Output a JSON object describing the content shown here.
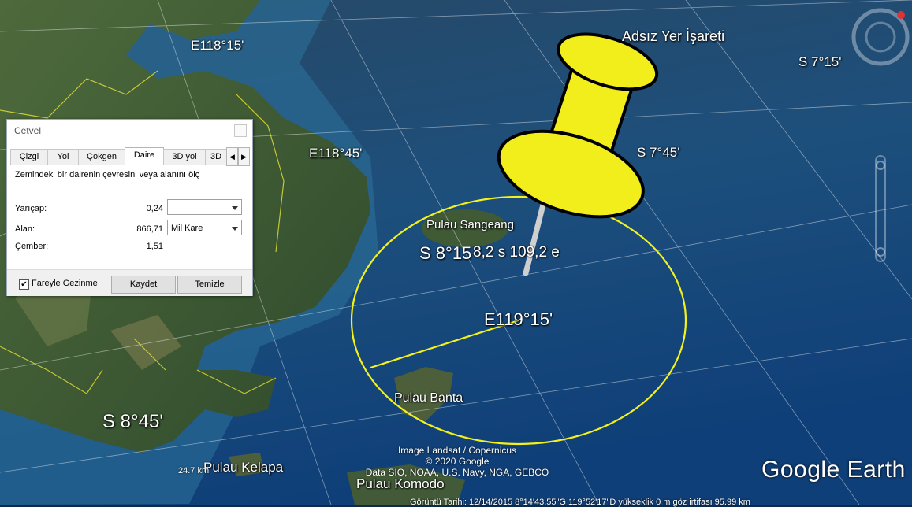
{
  "map": {
    "grid_labels": [
      {
        "id": "e118-15",
        "text": "E118°15'"
      },
      {
        "id": "e118-45",
        "text": "E118°45'"
      },
      {
        "id": "s7-15",
        "text": "S 7°15'"
      },
      {
        "id": "s7-45",
        "text": "S 7°45'"
      },
      {
        "id": "s8-15",
        "text": "S 8°15"
      },
      {
        "id": "e119-15",
        "text": "E119°15'"
      },
      {
        "id": "s8-45",
        "text": "S 8°45'"
      }
    ],
    "placemark_label": "Adsız Yer İşareti",
    "coord_overlay": "8,2 s 109,2 e",
    "islands": {
      "sangeang": "Pulau Sangeang",
      "banta": "Pulau Banta",
      "kelapa": "Pulau Kelapa",
      "komodo": "Pulau Komodo"
    },
    "credits": [
      "Image Landsat / Copernicus",
      "© 2020 Google",
      "Data SIO, NOAA, U.S. Navy, NGA, GEBCO"
    ],
    "logo": "Google Earth",
    "scale": "24.7 km",
    "status": "Görüntü Tarihi: 12/14/2015    8°14'43.55\"G  119°52'17\"D  yükseklik    0 m    göz irtifası  95.99 km",
    "colors": {
      "circle": "#f4f21a",
      "pin": "#f2ee1b"
    }
  },
  "ruler": {
    "title": "Cetvel",
    "tabs": [
      "Çizgi",
      "Yol",
      "Çokgen",
      "Daire",
      "3D yol",
      "3D"
    ],
    "active_tab": "Daire",
    "description": "Zemindeki bir dairenin çevresini veya alanını ölç",
    "radius_label": "Yarıçap:",
    "radius_value": "0,24",
    "radius_unit": "",
    "area_label": "Alan:",
    "area_value": "866,71",
    "area_unit": "Mil Kare",
    "circumference_label": "Çember:",
    "circumference_value": "1,51",
    "mouse_nav_label": "Fareyle Gezinme",
    "mouse_nav_checked": "✔",
    "save_label": "Kaydet",
    "clear_label": "Temizle"
  }
}
